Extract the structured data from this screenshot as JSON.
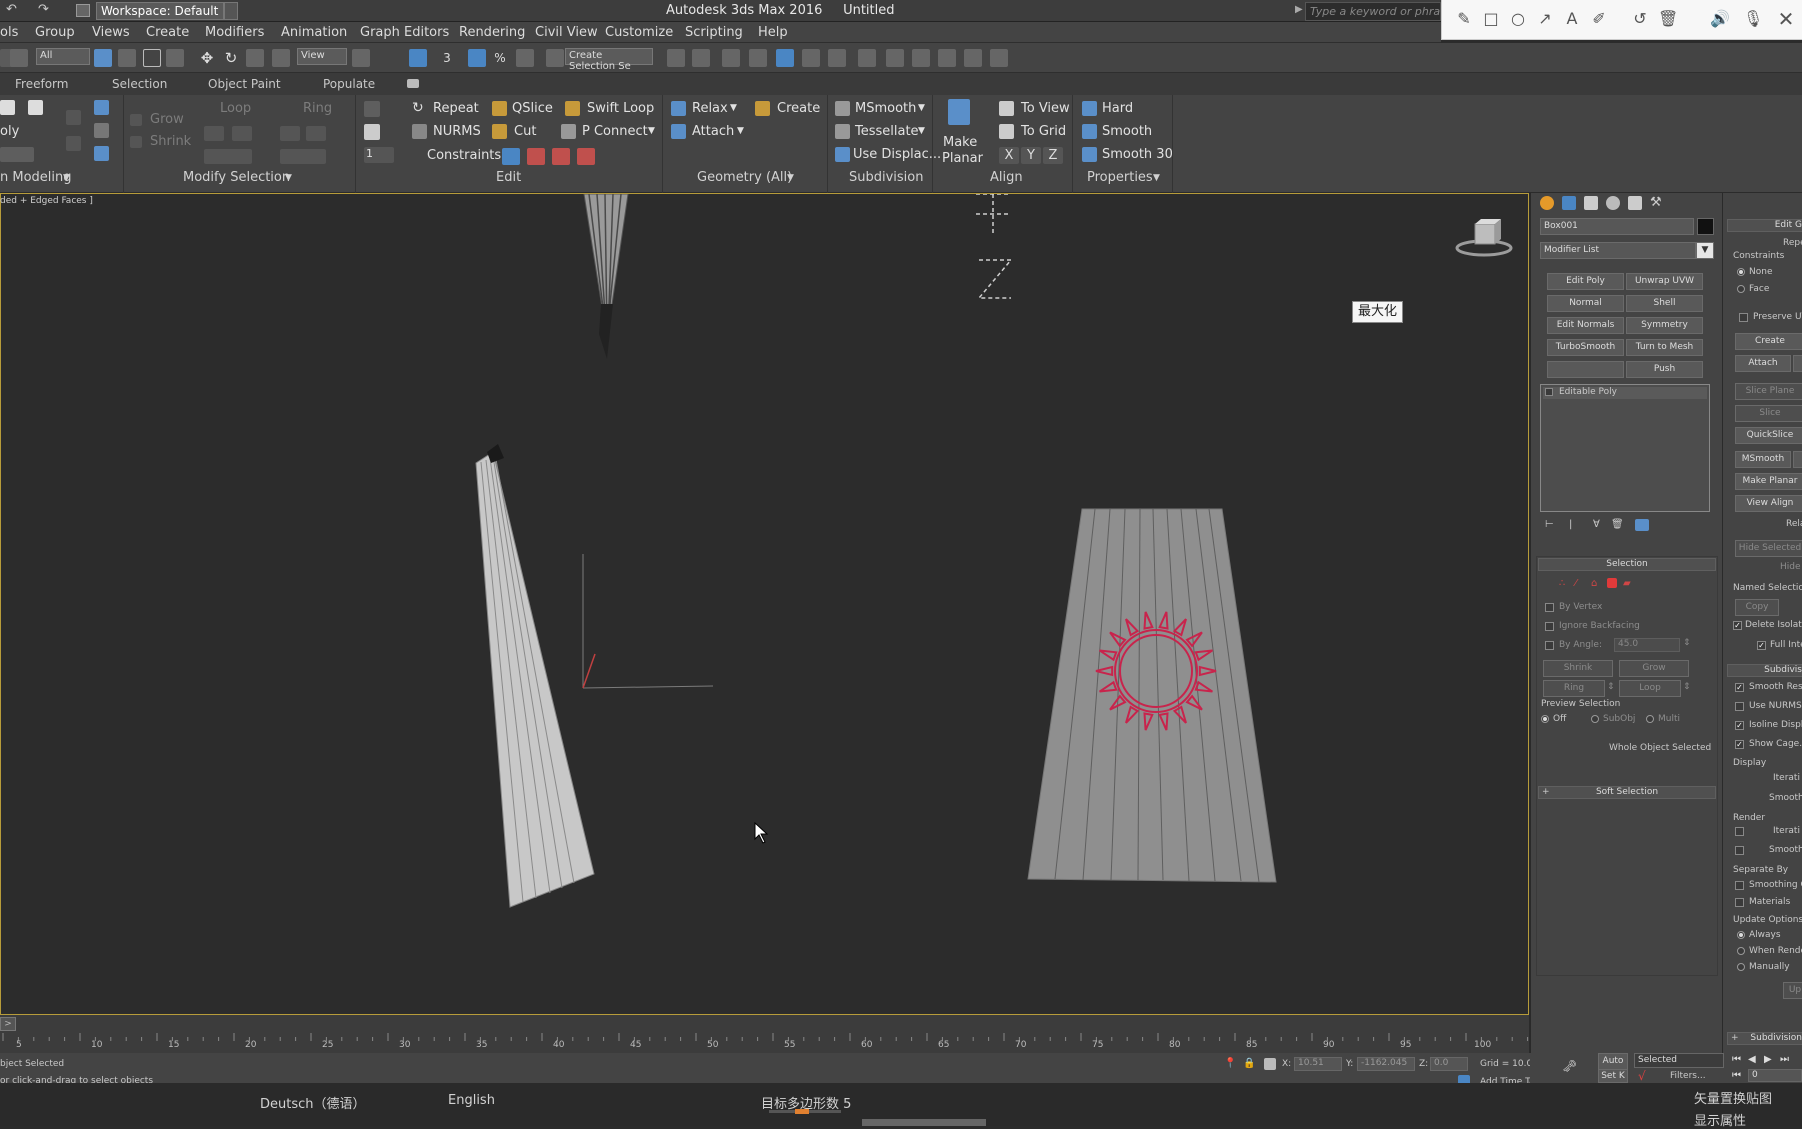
{
  "app": {
    "title": "Autodesk 3ds Max 2016",
    "document": "Untitled",
    "workspace": "Workspace: Default",
    "search_placeholder": "Type a keyword or phrase"
  },
  "annotation_tools": [
    "pencil-icon",
    "rectangle-icon",
    "circle-icon",
    "arrow-icon",
    "text-icon",
    "highlighter-icon",
    "undo-icon",
    "trash-icon",
    "speaker-icon",
    "microphone-icon",
    "close-icon"
  ],
  "menu": [
    "ols",
    "Group",
    "Views",
    "Create",
    "Modifiers",
    "Animation",
    "Graph Editors",
    "Rendering",
    "Civil View",
    "Customize",
    "Scripting",
    "Help"
  ],
  "toolbar": {
    "filter": "All",
    "ref_coord": "View",
    "selection_set": "Create Selection Se"
  },
  "ribbon_tabs": [
    "Freeform",
    "Selection",
    "Object Paint",
    "Populate"
  ],
  "ribbon": {
    "left_labels": {
      "oly": "oly",
      "grow": "Grow",
      "shrink": "Shrink",
      "loop": "Loop",
      "ring": "Ring"
    },
    "edit": {
      "repeat": "Repeat",
      "qslice": "QSlice",
      "swift_loop": "Swift Loop",
      "nurms": "NURMS",
      "cut": "Cut",
      "p_connect": "P Connect",
      "constraints": "Constraints:",
      "spinner_value": "1"
    },
    "geometry": {
      "relax": "Relax",
      "create": "Create",
      "attach": "Attach"
    },
    "subdivision": {
      "msmooth": "MSmooth",
      "tessellate": "Tessellate",
      "use_displace": "Use Displac..."
    },
    "align": {
      "make_planar_1": "Make",
      "make_planar_2": "Planar",
      "to_view": "To View",
      "to_grid": "To Grid",
      "x": "X",
      "y": "Y",
      "z": "Z"
    },
    "properties": {
      "hard": "Hard",
      "smooth": "Smooth",
      "smooth30": "Smooth 30"
    },
    "groups": {
      "modeling": "n Modeling",
      "modify_selection": "Modify Selection",
      "edit": "Edit",
      "geometry": "Geometry (All)",
      "subdivision": "Subdivision",
      "align": "Align",
      "properties": "Properties"
    }
  },
  "viewport": {
    "label": "ded + Edged Faces ]",
    "tooltip": "最大化"
  },
  "command_panel": {
    "object_name": "Box001",
    "modifier_list": "Modifier List",
    "modifier_buttons": [
      "Edit Poly",
      "Unwrap UVW",
      "Normal",
      "Shell",
      "Edit Normals",
      "Symmetry",
      "TurboSmooth",
      "Turn to Mesh",
      "",
      "Push"
    ],
    "stack_item": "Editable Poly",
    "selection_title": "Selection",
    "by_vertex": "By Vertex",
    "ignore_backfacing": "Ignore Backfacing",
    "by_angle": "By Angle:",
    "angle_value": "45.0",
    "shrink": "Shrink",
    "grow": "Grow",
    "ring": "Ring",
    "loop": "Loop",
    "preview_selection": "Preview Selection",
    "off": "Off",
    "subobj": "SubObj",
    "multi": "Multi",
    "whole_object": "Whole Object Selected",
    "soft_selection": "Soft Selection"
  },
  "right_panel": {
    "edit_geometry": "Edit G",
    "repeat": "Repe",
    "constraints": "Constraints",
    "none": "None",
    "face": "Face",
    "preserve_uvs": "Preserve UV",
    "create": "Create",
    "attach": "Attach",
    "slice_plane": "Slice Plane",
    "slice": "Slice",
    "quickslice": "QuickSlice",
    "msmooth": "MSmooth",
    "make_planar": "Make Planar",
    "view_align": "View Align",
    "relax": "Rela",
    "hide_selected": "Hide Selected",
    "hide_unselected": "Hide U",
    "named_selections": "Named Selections:",
    "copy": "Copy",
    "delete_isolated": "Delete Isolated",
    "full_interactivity": "Full Inte",
    "subdivision": "Subdivis",
    "smooth_result": "Smooth Result",
    "use_nurms": "Use NURMS Su",
    "isoline_display": "Isoline Display",
    "show_cage": "Show Cage......",
    "display": "Display",
    "iterations1": "Iterati",
    "smoothness1": "Smoothn",
    "render": "Render",
    "iterations2": "Iterati",
    "smoothness2": "Smoothn",
    "separate_by": "Separate By",
    "smoothing_groups": "Smoothing Gro",
    "materials": "Materials",
    "update_options": "Update Options",
    "always": "Always",
    "when_rendering": "When Renderin",
    "manually": "Manually",
    "update": "Up",
    "subdivision2": "Subdivision"
  },
  "timeline": {
    "ticks": [
      "5",
      "10",
      "15",
      "20",
      "25",
      "30",
      "35",
      "40",
      "45",
      "50",
      "55",
      "60",
      "65",
      "70",
      "75",
      "80",
      "85",
      "90",
      "95",
      "100"
    ]
  },
  "status": {
    "selected": "bject Selected",
    "prompt": "or click-and-drag to select objects",
    "x": "10.51",
    "y": "-1162.045",
    "z": "0.0",
    "grid": "Grid = 10.0",
    "auto": "Auto",
    "selected_dd": "Selected",
    "set_key": "Set K",
    "filters": "Filters...",
    "add_time_tag": "Add Time Tag",
    "frame": "0"
  },
  "bottom": {
    "lang1": "Deutsch（德语）",
    "lang2": "English",
    "target": "目标多边形数 5",
    "r1": "矢量置换贴图",
    "r2": "显示属性"
  }
}
